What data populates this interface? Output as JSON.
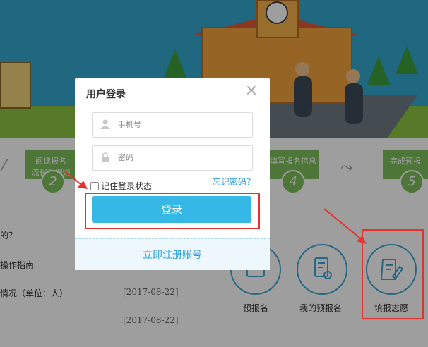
{
  "background": {
    "steps": [
      {
        "label_line1": "阅读报名",
        "label_line2": "流程及细则",
        "number": "2"
      },
      {
        "label_line1": "填写报名信息",
        "label_line2": "",
        "number": "4"
      },
      {
        "label_line1": "完成预报",
        "label_line2": "",
        "number": "5"
      }
    ],
    "list_items": [
      {
        "text": "的？",
        "date": ""
      },
      {
        "text": "操作指南",
        "date": ""
      },
      {
        "text": "情况（单位：人）",
        "date": "[2017-08-22]"
      },
      {
        "text": "",
        "date": "[2017-08-22]"
      }
    ],
    "services": [
      {
        "label": "预报名",
        "icon": "enroll-icon"
      },
      {
        "label": "我的预报名",
        "icon": "my-enroll-icon"
      },
      {
        "label": "填报志愿",
        "icon": "fill-wish-icon"
      }
    ]
  },
  "modal": {
    "title": "用户登录",
    "close_icon": "close-icon",
    "phone_placeholder": "手机号",
    "password_placeholder": "密码",
    "remember_label": "记住登录状态",
    "forgot_label": "忘记密码？",
    "login_label": "登录",
    "register_label": "立即注册账号"
  },
  "colors": {
    "accent": "#35b8e6",
    "link": "#2e9fd8",
    "highlight": "#e5322d",
    "step_green": "#7fbf5b"
  }
}
